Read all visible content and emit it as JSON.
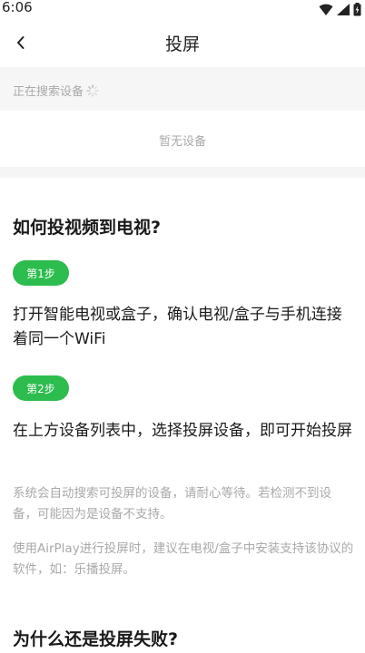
{
  "status_bar": {
    "time": "6:06",
    "icons": [
      "wifi-icon",
      "signal-icon",
      "battery-icon"
    ]
  },
  "nav": {
    "back_icon": "chevron-left-icon",
    "title": "投屏"
  },
  "search": {
    "label": "正在搜索设备",
    "spinner_icon": "loading-spinner-icon"
  },
  "devices": {
    "empty_text": "暂无设备"
  },
  "guide": {
    "title": "如何投视频到电视?",
    "steps": [
      {
        "badge": "第1步",
        "text": "打开智能电视或盒子，确认电视/盒子与手机连接着同一个WiFi"
      },
      {
        "badge": "第2步",
        "text": "在上方设备列表中，选择投屏设备，即可开始投屏"
      }
    ],
    "notes": [
      "系统会自动搜索可投屏的设备，请耐心等待。若检测不到设备，可能因为是设备不支持。",
      "使用AirPlay进行投屏时，建议在电视/盒子中安装支持该协议的软件，如：乐播投屏。"
    ]
  },
  "faq": {
    "title": "为什么还是投屏失败?"
  },
  "colors": {
    "accent_green": "#2dbc4e",
    "muted_text": "#a9a9a9",
    "band_background": "#f5f5f5"
  }
}
